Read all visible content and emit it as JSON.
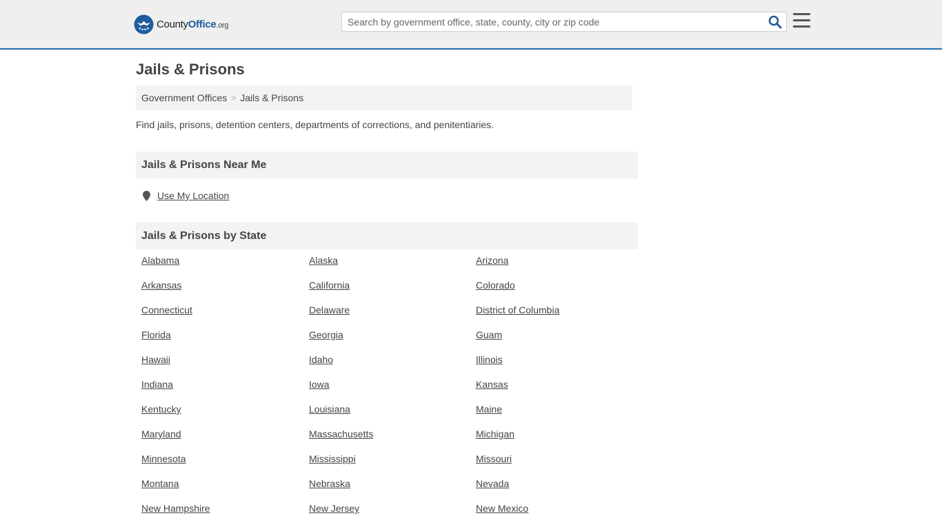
{
  "header": {
    "logo": {
      "part1": "County",
      "part2": "Office",
      "part3": ".org"
    },
    "search_placeholder": "Search by government office, state, county, city or zip code",
    "icons": {
      "search": "search-icon",
      "menu": "hamburger-menu-icon"
    }
  },
  "page": {
    "title": "Jails & Prisons",
    "breadcrumb": [
      {
        "label": "Government Offices"
      },
      {
        "label": "Jails & Prisons"
      }
    ],
    "breadcrumb_separator": ">",
    "description": "Find jails, prisons, detention centers, departments of corrections, and penitentiaries.",
    "near_me": {
      "heading": "Jails & Prisons Near Me",
      "link": "Use My Location",
      "icon": "map-pin-icon"
    },
    "by_state": {
      "heading": "Jails & Prisons by State",
      "states": [
        "Alabama",
        "Alaska",
        "Arizona",
        "Arkansas",
        "California",
        "Colorado",
        "Connecticut",
        "Delaware",
        "District of Columbia",
        "Florida",
        "Georgia",
        "Guam",
        "Hawaii",
        "Idaho",
        "Illinois",
        "Indiana",
        "Iowa",
        "Kansas",
        "Kentucky",
        "Louisiana",
        "Maine",
        "Maryland",
        "Massachusetts",
        "Michigan",
        "Minnesota",
        "Mississippi",
        "Missouri",
        "Montana",
        "Nebraska",
        "Nevada",
        "New Hampshire",
        "New Jersey",
        "New Mexico"
      ]
    }
  },
  "colors": {
    "header_bg": "#efefef",
    "header_border": "#1f6fb2",
    "brand_blue": "#1f5c9e",
    "section_bg": "#f3f3f3"
  }
}
